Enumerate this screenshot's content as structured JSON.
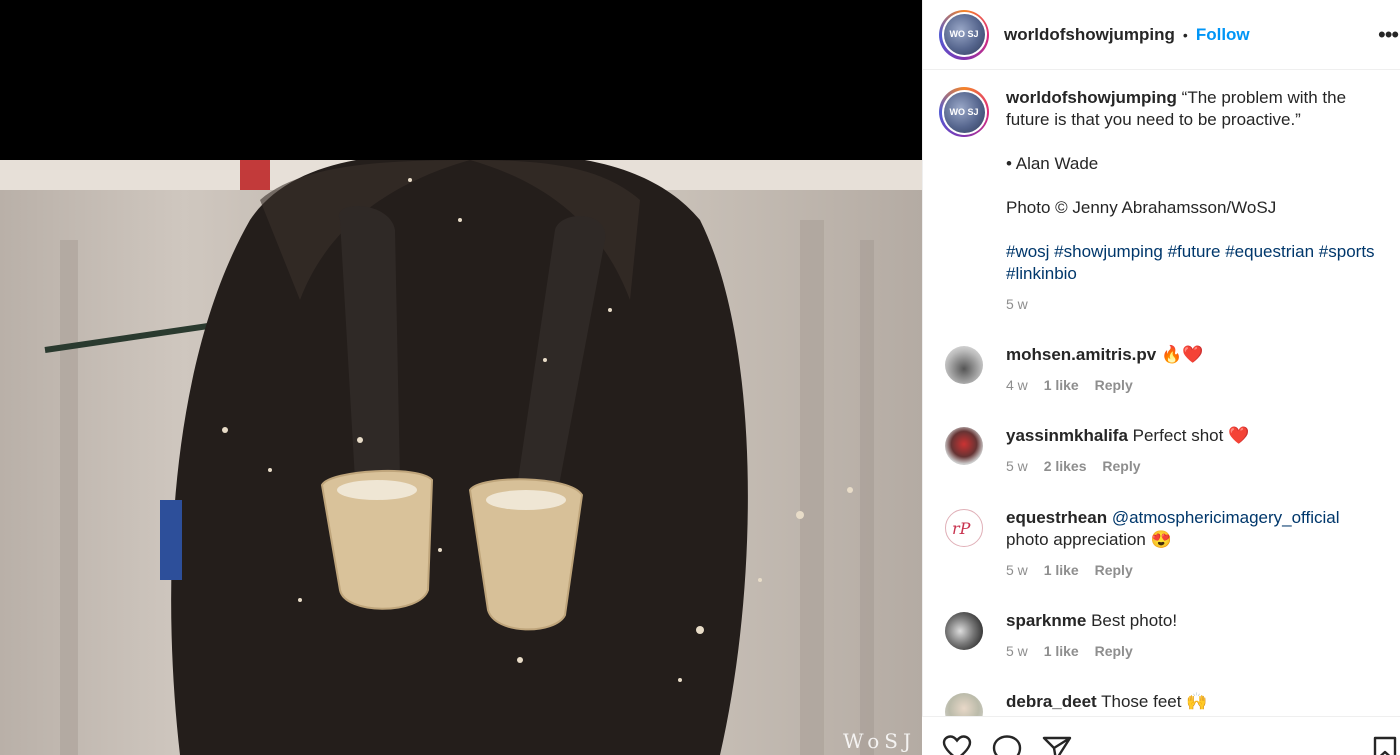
{
  "post": {
    "username": "worldofshowjumping",
    "separator": "•",
    "follow_label": "Follow",
    "more_label": "•••",
    "watermark": "WoSJ",
    "avatar_text": "WO SJ"
  },
  "caption": {
    "username": "worldofshowjumping",
    "quote": "“The problem with the future is that you need to be proactive.”",
    "author": "• Alan Wade",
    "photo_credit": "Photo © Jenny Abrahamsson/WoSJ",
    "hashtags": "#wosj #showjumping #future #equestrian #sports #linkinbio",
    "time": "5 w"
  },
  "comments": [
    {
      "username": "mohsen.amitris.pv",
      "text": "🔥❤️",
      "time": "4 w",
      "likes": "1 like",
      "reply": "Reply"
    },
    {
      "username": "yassinmkhalifa",
      "text": "Perfect shot ❤️",
      "time": "5 w",
      "likes": "2 likes",
      "reply": "Reply"
    },
    {
      "username": "equestrhean",
      "mention": "@atmosphericimagery_official",
      "text": "photo appreciation 😍",
      "time": "5 w",
      "likes": "1 like",
      "reply": "Reply"
    },
    {
      "username": "sparknme",
      "text": "Best photo!",
      "time": "5 w",
      "likes": "1 like",
      "reply": "Reply"
    },
    {
      "username": "debra_deet",
      "text": "Those feet 🙌"
    }
  ],
  "colors": {
    "follow": "#0095f6",
    "hashtag": "#00376b",
    "meta": "#8e8e8e",
    "text": "#262626"
  },
  "icons": [
    "heart-icon",
    "comment-icon",
    "share-icon",
    "bookmark-icon",
    "more-options-icon"
  ]
}
